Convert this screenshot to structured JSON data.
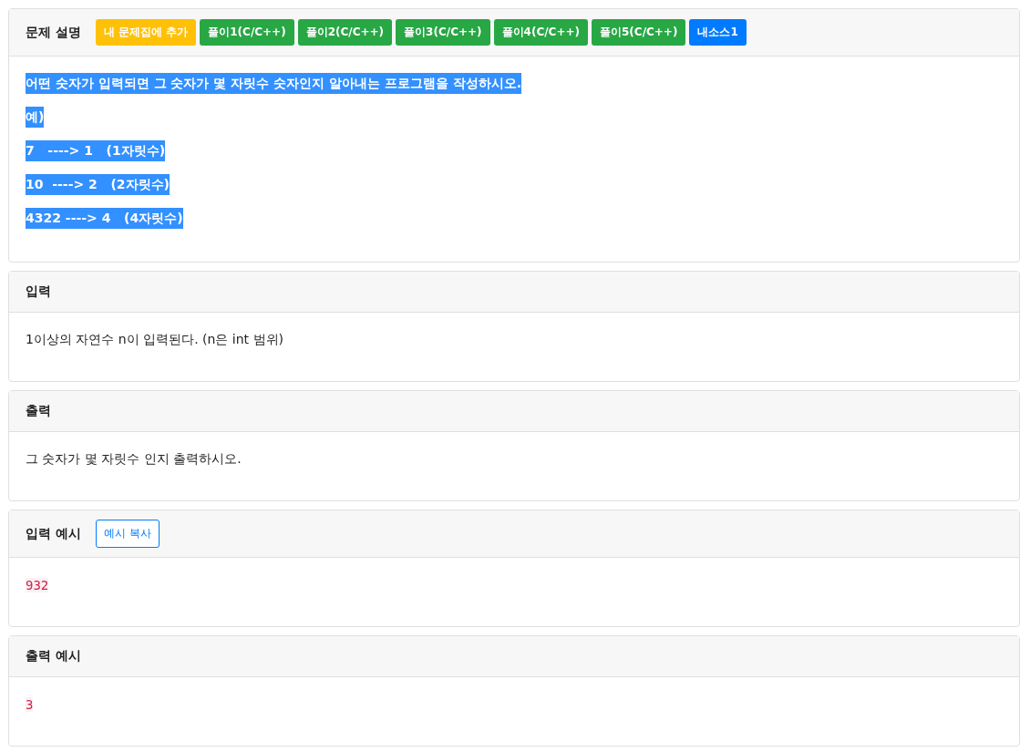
{
  "sections": [
    {
      "title": "문제 설명",
      "buttons": [
        {
          "label": "내 문제집에 추가",
          "kind": "warning"
        },
        {
          "label": "풀이1(C/C++)",
          "kind": "success"
        },
        {
          "label": "풀이2(C/C++)",
          "kind": "success"
        },
        {
          "label": "풀이3(C/C++)",
          "kind": "success"
        },
        {
          "label": "풀이4(C/C++)",
          "kind": "success"
        },
        {
          "label": "풀이5(C/C++)",
          "kind": "success"
        },
        {
          "label": "내소스1",
          "kind": "primary"
        }
      ],
      "kind": "text",
      "text_selected": true,
      "lines": [
        "어떤 숫자가 입력되면 그 숫자가 몇 자릿수 숫자인지 알아내는 프로그램을 작성하시오.",
        "예)",
        "7   ----> 1   (1자릿수)",
        "10  ----> 2   (2자릿수)",
        "4322 ----> 4   (4자릿수)"
      ]
    },
    {
      "title": "입력",
      "kind": "text",
      "text_selected": false,
      "lines": [
        "1이상의 자연수 n이 입력된다. (n은 int 범위)"
      ]
    },
    {
      "title": "출력",
      "kind": "text",
      "text_selected": false,
      "lines": [
        "그 숫자가 몇 자릿수 인지 출력하시오."
      ]
    },
    {
      "title": "입력 예시",
      "buttons": [
        {
          "label": "예시 복사",
          "kind": "outline"
        }
      ],
      "kind": "sample",
      "lines": [
        "932"
      ]
    },
    {
      "title": "출력 예시",
      "kind": "sample",
      "lines": [
        "3"
      ]
    }
  ]
}
